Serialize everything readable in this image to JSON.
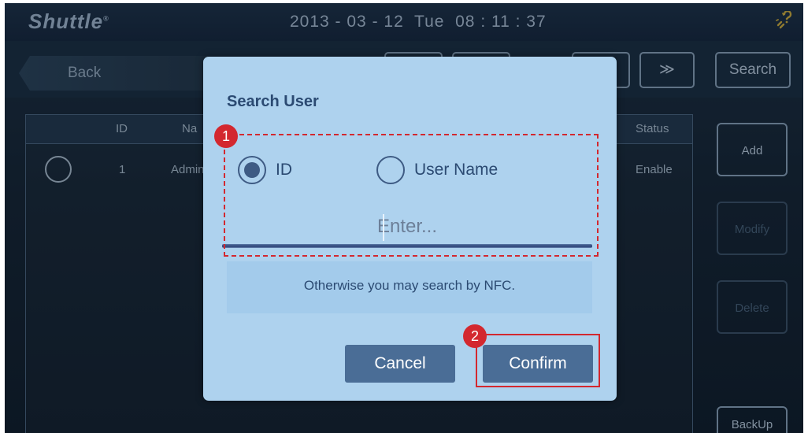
{
  "header": {
    "logo": "Shuttle",
    "logo_mark": "®",
    "datetime": "2013 - 03 - 12  Tue  08 : 11 : 37",
    "link_icon": "broken-link-icon"
  },
  "toolbar": {
    "back_label": "Back",
    "next_label": "≫",
    "search_label": "Search"
  },
  "table": {
    "headers": {
      "id": "ID",
      "name": "Na",
      "status": "Status"
    },
    "rows": [
      {
        "id": "1",
        "name": "Admini",
        "status": "Enable"
      }
    ]
  },
  "side_buttons": {
    "add": "Add",
    "modify": "Modify",
    "delete": "Delete",
    "backup": "BackUp"
  },
  "dialog": {
    "title": "Search User",
    "options": [
      {
        "label": "ID",
        "selected": true
      },
      {
        "label": "User Name",
        "selected": false
      }
    ],
    "input_placeholder": "Enter...",
    "input_value": "",
    "hint": "Otherwise you may search by NFC.",
    "cancel_label": "Cancel",
    "confirm_label": "Confirm"
  },
  "annotations": {
    "badge_1": "1",
    "badge_2": "2",
    "color": "#d3282f"
  },
  "colors": {
    "dialog_bg": "#aed2ee",
    "dialog_text": "#2b4a72",
    "button_bg": "#4a6d96"
  }
}
